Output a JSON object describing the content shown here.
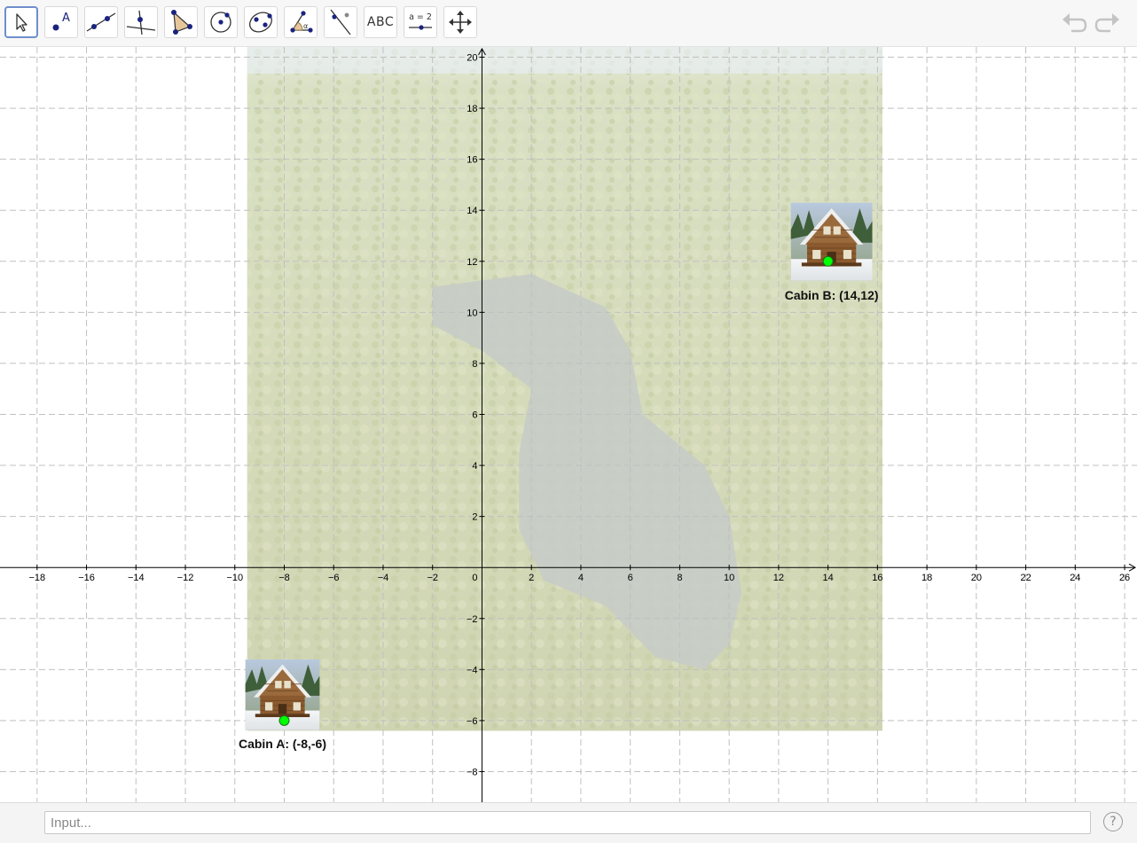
{
  "toolbar": {
    "tools": [
      {
        "name": "move",
        "icon": "move-cursor-icon",
        "label": ""
      },
      {
        "name": "point",
        "icon": "point-icon",
        "label": "A"
      },
      {
        "name": "line",
        "icon": "line-icon",
        "label": ""
      },
      {
        "name": "perpendicular",
        "icon": "perpendicular-line-icon",
        "label": ""
      },
      {
        "name": "polygon",
        "icon": "polygon-icon",
        "label": ""
      },
      {
        "name": "circle",
        "icon": "circle-center-point-icon",
        "label": ""
      },
      {
        "name": "ellipse",
        "icon": "ellipse-icon",
        "label": ""
      },
      {
        "name": "angle",
        "icon": "angle-icon",
        "label": "α"
      },
      {
        "name": "reflect",
        "icon": "reflect-line-icon",
        "label": ""
      },
      {
        "name": "text",
        "icon": "text-icon",
        "label": "ABC"
      },
      {
        "name": "slider",
        "icon": "slider-icon",
        "label": "a = 2"
      },
      {
        "name": "move-graphics",
        "icon": "move-graphics-icon",
        "label": ""
      }
    ],
    "selected": "move",
    "undo_icon": "undo-icon",
    "redo_icon": "redo-icon"
  },
  "graph": {
    "x_range": [
      -19.5,
      26.5
    ],
    "y_range": [
      -9.2,
      20.4
    ],
    "grid": true,
    "x_ticks": [
      -18,
      -16,
      -14,
      -12,
      -10,
      -8,
      -6,
      -4,
      -2,
      2,
      4,
      6,
      8,
      10,
      12,
      14,
      16,
      18,
      20,
      22,
      24,
      26
    ],
    "y_ticks": [
      -8,
      -6,
      -4,
      -2,
      2,
      4,
      6,
      8,
      10,
      12,
      14,
      16,
      18,
      20
    ],
    "origin_label": "0",
    "background_image": {
      "x_range": [
        -9.5,
        16.2
      ],
      "y_range": [
        -6.4,
        20.4
      ],
      "description_icon": "aerial-lake-forest-image"
    },
    "colors": {
      "grid": "#c0c0c0",
      "axis": "#000000",
      "point_fill": "#00ff00",
      "point_stroke": "#1a6b1a"
    },
    "points": [
      {
        "label": "Cabin A: (-8,-6)",
        "x": -8,
        "y": -6,
        "image": "cabin-image",
        "image_anchor": "bottom-left-of-point"
      },
      {
        "label": "Cabin B: (14,12)",
        "x": 14,
        "y": 12,
        "image": "cabin-image",
        "image_anchor": "around-point"
      }
    ]
  },
  "input_bar": {
    "placeholder": "Input...",
    "help_label": "?"
  }
}
